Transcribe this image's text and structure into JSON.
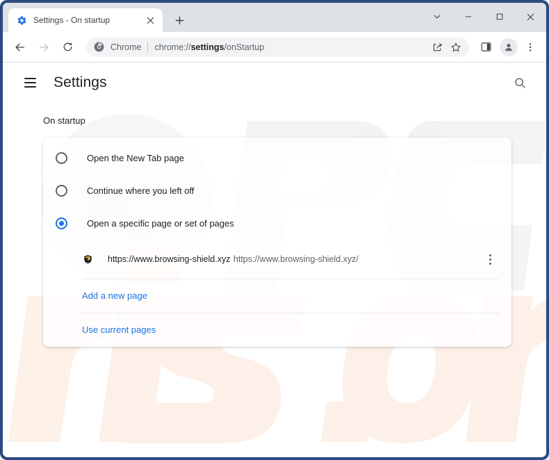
{
  "window": {
    "controls": {
      "tab_search_label": "Search tabs",
      "minimize_label": "Minimize",
      "maximize_label": "Maximize",
      "close_label": "Close"
    }
  },
  "tabstrip": {
    "tabs": [
      {
        "title": "Settings - On startup",
        "favicon": "gear-icon",
        "close_label": "Close tab",
        "active": true
      }
    ],
    "new_tab_label": "New Tab"
  },
  "toolbar": {
    "back_label": "Back",
    "forward_label": "Forward",
    "reload_label": "Reload",
    "omnibox": {
      "icon": "chrome-logo-icon",
      "scheme_label": "Chrome",
      "url_prefix": "chrome://",
      "url_bold": "settings",
      "url_suffix": "/onStartup",
      "full_url": "chrome://settings/onStartup"
    },
    "share_label": "Share this page",
    "bookmark_label": "Bookmark this tab",
    "side_panel_label": "Show side panel",
    "profile_label": "Profile",
    "menu_label": "Customize and control Google Chrome"
  },
  "settings": {
    "menu_label": "Main menu",
    "title": "Settings",
    "search_label": "Search settings",
    "section_title": "On startup",
    "options": [
      {
        "label": "Open the New Tab page",
        "selected": false
      },
      {
        "label": "Continue where you left off",
        "selected": false
      },
      {
        "label": "Open a specific page or set of pages",
        "selected": true
      }
    ],
    "startup_pages": [
      {
        "title": "https://www.browsing-shield.xyz",
        "url": "https://www.browsing-shield.xyz/",
        "favicon": "shield-favicon-icon",
        "menu_label": "More actions"
      }
    ],
    "add_page_label": "Add a new page",
    "use_current_label": "Use current pages"
  },
  "watermark": {
    "top_text": "PC",
    "bottom_text": "risk.com"
  },
  "colors": {
    "accent_blue": "#1a73e8",
    "window_border": "#2b4b80",
    "tabstrip_bg": "#dee1e6",
    "omnibox_bg": "#f1f3f4",
    "text_primary": "#202124",
    "text_secondary": "#5f6368",
    "watermark_gray": "#f1f3f5",
    "watermark_peach": "#fdf0e7"
  }
}
